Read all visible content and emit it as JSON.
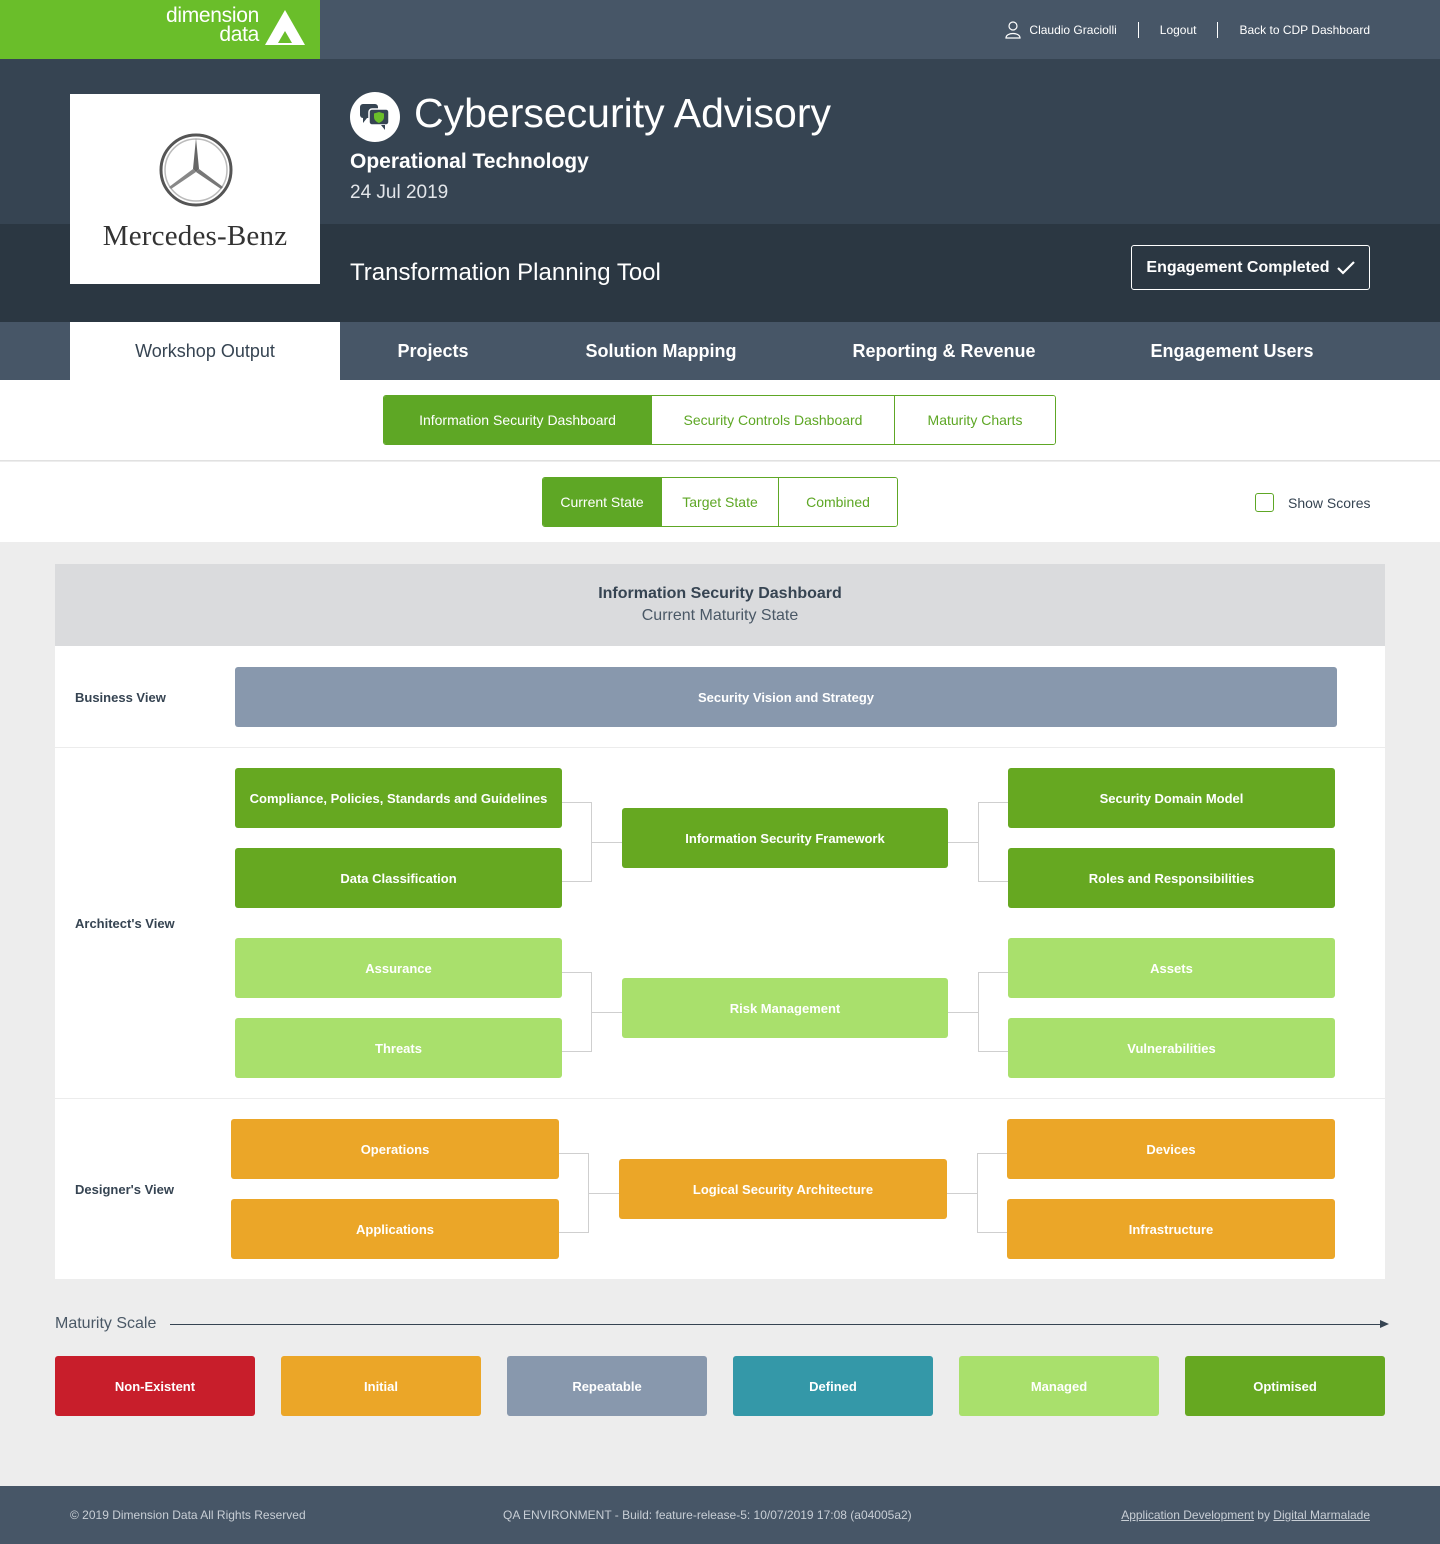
{
  "brand": {
    "logo_text_1": "dimension",
    "logo_text_2": "data"
  },
  "topnav": {
    "user": "Claudio Graciolli",
    "logout": "Logout",
    "back": "Back to CDP Dashboard"
  },
  "header": {
    "client_name": "Mercedes-Benz",
    "title": "Cybersecurity Advisory",
    "subtitle": "Operational Technology",
    "date": "24 Jul 2019",
    "tool_title": "Transformation Planning Tool",
    "engagement_button": "Engagement Completed"
  },
  "tabs": [
    "Workshop Output",
    "Projects",
    "Solution Mapping",
    "Reporting & Revenue",
    "Engagement Users"
  ],
  "subtabs": [
    "Information Security Dashboard",
    "Security Controls Dashboard",
    "Maturity Charts"
  ],
  "states": [
    "Current State",
    "Target State",
    "Combined"
  ],
  "show_scores": "Show Scores",
  "dashboard": {
    "title": "Information Security Dashboard",
    "subtitle": "Current Maturity State",
    "rows": {
      "business": "Business View",
      "architect": "Architect's View",
      "designer": "Designer's View"
    },
    "boxes": {
      "vision": "Security Vision and Strategy",
      "compliance": "Compliance, Policies, Standards and Guidelines",
      "data_class": "Data Classification",
      "isf": "Information Security Framework",
      "domain_model": "Security Domain Model",
      "roles": "Roles and Responsibilities",
      "assurance": "Assurance",
      "threats": "Threats",
      "risk": "Risk Management",
      "assets": "Assets",
      "vulns": "Vulnerabilities",
      "operations": "Operations",
      "applications": "Applications",
      "lsa": "Logical Security Architecture",
      "devices": "Devices",
      "infrastructure": "Infrastructure"
    }
  },
  "scale": {
    "label": "Maturity Scale",
    "levels": [
      "Non-Existent",
      "Initial",
      "Repeatable",
      "Defined",
      "Managed",
      "Optimised"
    ],
    "colors": [
      "#c81e2b",
      "#eba628",
      "#8898ad",
      "#3498a8",
      "#a9e06c",
      "#66a821"
    ]
  },
  "footer": {
    "copyright": "© 2019 Dimension Data All Rights Reserved",
    "build": "QA ENVIRONMENT - Build: feature-release-5: 10/07/2019 17:08 (a04005a2)",
    "credit_link": "Application Development",
    "credit_by": " by ",
    "credit_company": "Digital Marmalade"
  }
}
